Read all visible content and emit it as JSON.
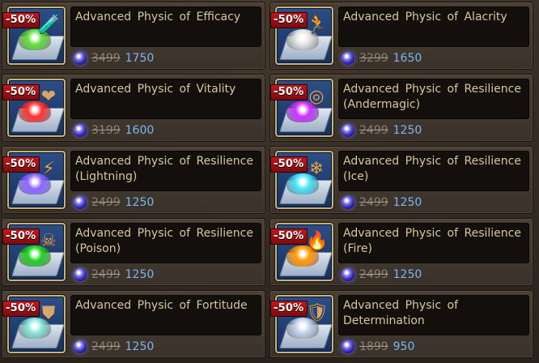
{
  "discount_label": "-50%",
  "items": [
    {
      "name": "Advanced Physic of Efficacy",
      "old_price": "3499",
      "new_price": "1750",
      "powder_color": "#7ad65a",
      "emblem": "test-tube-icon",
      "emblem_glyph": "🧪"
    },
    {
      "name": "Advanced Physic of Alacrity",
      "old_price": "3299",
      "new_price": "1650",
      "powder_color": "#e4e4e4",
      "emblem": "running-figure-icon",
      "emblem_glyph": "🏃"
    },
    {
      "name": "Advanced Physic of Vitality",
      "old_price": "3199",
      "new_price": "1600",
      "powder_color": "#e23a3a",
      "emblem": "heart-plus-icon",
      "emblem_glyph": "❤"
    },
    {
      "name": "Advanced Physic of Resilience (Andermagic)",
      "old_price": "2499",
      "new_price": "1250",
      "powder_color": "#b43ce6",
      "emblem": "rune-circle-icon",
      "emblem_glyph": "◎"
    },
    {
      "name": "Advanced Physic of Resilience (Lightning)",
      "old_price": "2499",
      "new_price": "1250",
      "powder_color": "#8a6cff",
      "emblem": "lightning-icon",
      "emblem_glyph": "⚡"
    },
    {
      "name": "Advanced Physic of Resilience (Ice)",
      "old_price": "2499",
      "new_price": "1250",
      "powder_color": "#66e0f0",
      "emblem": "snowflake-icon",
      "emblem_glyph": "❄"
    },
    {
      "name": "Advanced Physic of Resilience (Poison)",
      "old_price": "2499",
      "new_price": "1250",
      "powder_color": "#3ec93e",
      "emblem": "skull-crossbones-icon",
      "emblem_glyph": "☠"
    },
    {
      "name": "Advanced Physic of Resilience (Fire)",
      "old_price": "2499",
      "new_price": "1250",
      "powder_color": "#ff9d1f",
      "emblem": "flame-icon",
      "emblem_glyph": "🔥"
    },
    {
      "name": "Advanced Physic of Fortitude",
      "old_price": "2499",
      "new_price": "1250",
      "powder_color": "#9be0d6",
      "emblem": "armor-icon",
      "emblem_glyph": "⛊"
    },
    {
      "name": "Advanced Physic of Determination",
      "old_price": "1899",
      "new_price": "950",
      "powder_color": "#c8d2e6",
      "emblem": "shield-icon",
      "emblem_glyph": "🛡"
    }
  ],
  "currency_icon": "soul-orb-icon"
}
